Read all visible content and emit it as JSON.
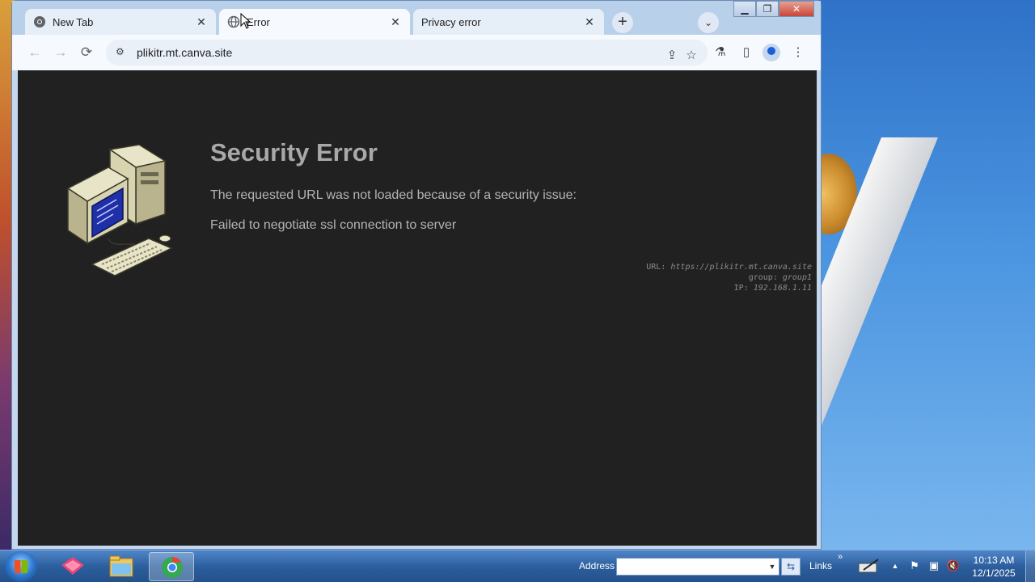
{
  "browser": {
    "tabs": [
      {
        "label": "New Tab",
        "icon": "chrome-icon",
        "active": false
      },
      {
        "label": "Error",
        "icon": "globe-icon",
        "active": true
      },
      {
        "label": "Privacy error",
        "icon": "",
        "active": false
      }
    ],
    "tab_close_glyph": "✕",
    "new_tab_glyph": "+",
    "tab_search_glyph": "⌄",
    "window_controls": {
      "minimize": "▁",
      "maximize": "❐",
      "close": "✕"
    },
    "nav": {
      "back": "←",
      "forward": "→",
      "reload": "⟳"
    },
    "address": {
      "url": "plikitr.mt.canva.site",
      "site_info_glyph": "⚙"
    },
    "actions": {
      "share": "⇪",
      "bookmark": "☆",
      "labs": "⚗",
      "side_panel": "▯",
      "menu": "⋮"
    }
  },
  "page": {
    "title": "Security Error",
    "message": "The requested URL was not loaded because of a security issue:",
    "detail": "Failed to negotiate ssl connection to server",
    "meta": {
      "url_label": "URL:",
      "url_value": "https://plikitr.mt.canva.site",
      "group_label": "group:",
      "group_value": "group1",
      "ip_label": "IP:",
      "ip_value": "192.168.1.11"
    }
  },
  "taskbar": {
    "address_label": "Address",
    "address_value": "",
    "go_glyph": "⇆",
    "links_label": "Links",
    "links_chevron": "»",
    "tray": {
      "expand": "▲",
      "flag": "⚑",
      "network": "▣",
      "volume": "🔇"
    },
    "clock_time": "10:13 AM",
    "clock_date": "12/1/2025"
  },
  "colors": {
    "page_bg": "#212121",
    "title": "#a8a8a8",
    "text": "#b4b4b4",
    "meta": "#8a8a8a"
  }
}
